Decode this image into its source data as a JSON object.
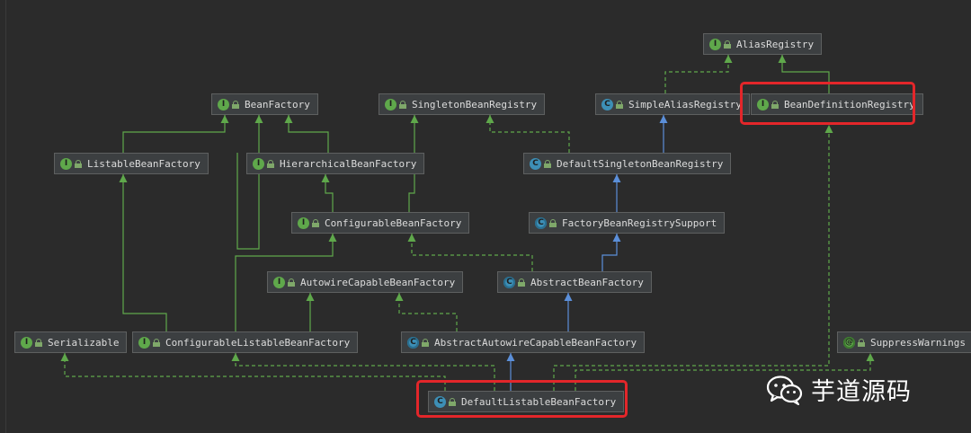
{
  "nodes": [
    {
      "id": "AliasRegistry",
      "label": "AliasRegistry",
      "kind": "i"
    },
    {
      "id": "BeanFactory",
      "label": "BeanFactory",
      "kind": "i"
    },
    {
      "id": "SingletonBeanRegistry",
      "label": "SingletonBeanRegistry",
      "kind": "i"
    },
    {
      "id": "SimpleAliasRegistry",
      "label": "SimpleAliasRegistry",
      "kind": "c"
    },
    {
      "id": "BeanDefinitionRegistry",
      "label": "BeanDefinitionRegistry",
      "kind": "i"
    },
    {
      "id": "ListableBeanFactory",
      "label": "ListableBeanFactory",
      "kind": "i"
    },
    {
      "id": "HierarchicalBeanFactory",
      "label": "HierarchicalBeanFactory",
      "kind": "i"
    },
    {
      "id": "DefaultSingletonBeanRegistry",
      "label": "DefaultSingletonBeanRegistry",
      "kind": "c"
    },
    {
      "id": "ConfigurableBeanFactory",
      "label": "ConfigurableBeanFactory",
      "kind": "i"
    },
    {
      "id": "FactoryBeanRegistrySupport",
      "label": "FactoryBeanRegistrySupport",
      "kind": "ac"
    },
    {
      "id": "AutowireCapableBeanFactory",
      "label": "AutowireCapableBeanFactory",
      "kind": "i"
    },
    {
      "id": "AbstractBeanFactory",
      "label": "AbstractBeanFactory",
      "kind": "ac"
    },
    {
      "id": "Serializable",
      "label": "Serializable",
      "kind": "i"
    },
    {
      "id": "ConfigurableListableBeanFactory",
      "label": "ConfigurableListableBeanFactory",
      "kind": "i"
    },
    {
      "id": "AbstractAutowireCapableBeanFactory",
      "label": "AbstractAutowireCapableBeanFactory",
      "kind": "ac"
    },
    {
      "id": "SuppressWarnings",
      "label": "SuppressWarnings",
      "kind": "a"
    },
    {
      "id": "DefaultListableBeanFactory",
      "label": "DefaultListableBeanFactory",
      "kind": "c"
    }
  ],
  "highlighted": [
    "BeanDefinitionRegistry",
    "DefaultListableBeanFactory"
  ],
  "watermark": {
    "text": "芋道源码",
    "icon": "wechat-icon"
  },
  "colors": {
    "background": "#2b2b2b",
    "node_bg": "#3c3f41",
    "interface_edge": "#5fa84b",
    "class_edge": "#5b8fd9",
    "highlight": "#e3262a"
  }
}
